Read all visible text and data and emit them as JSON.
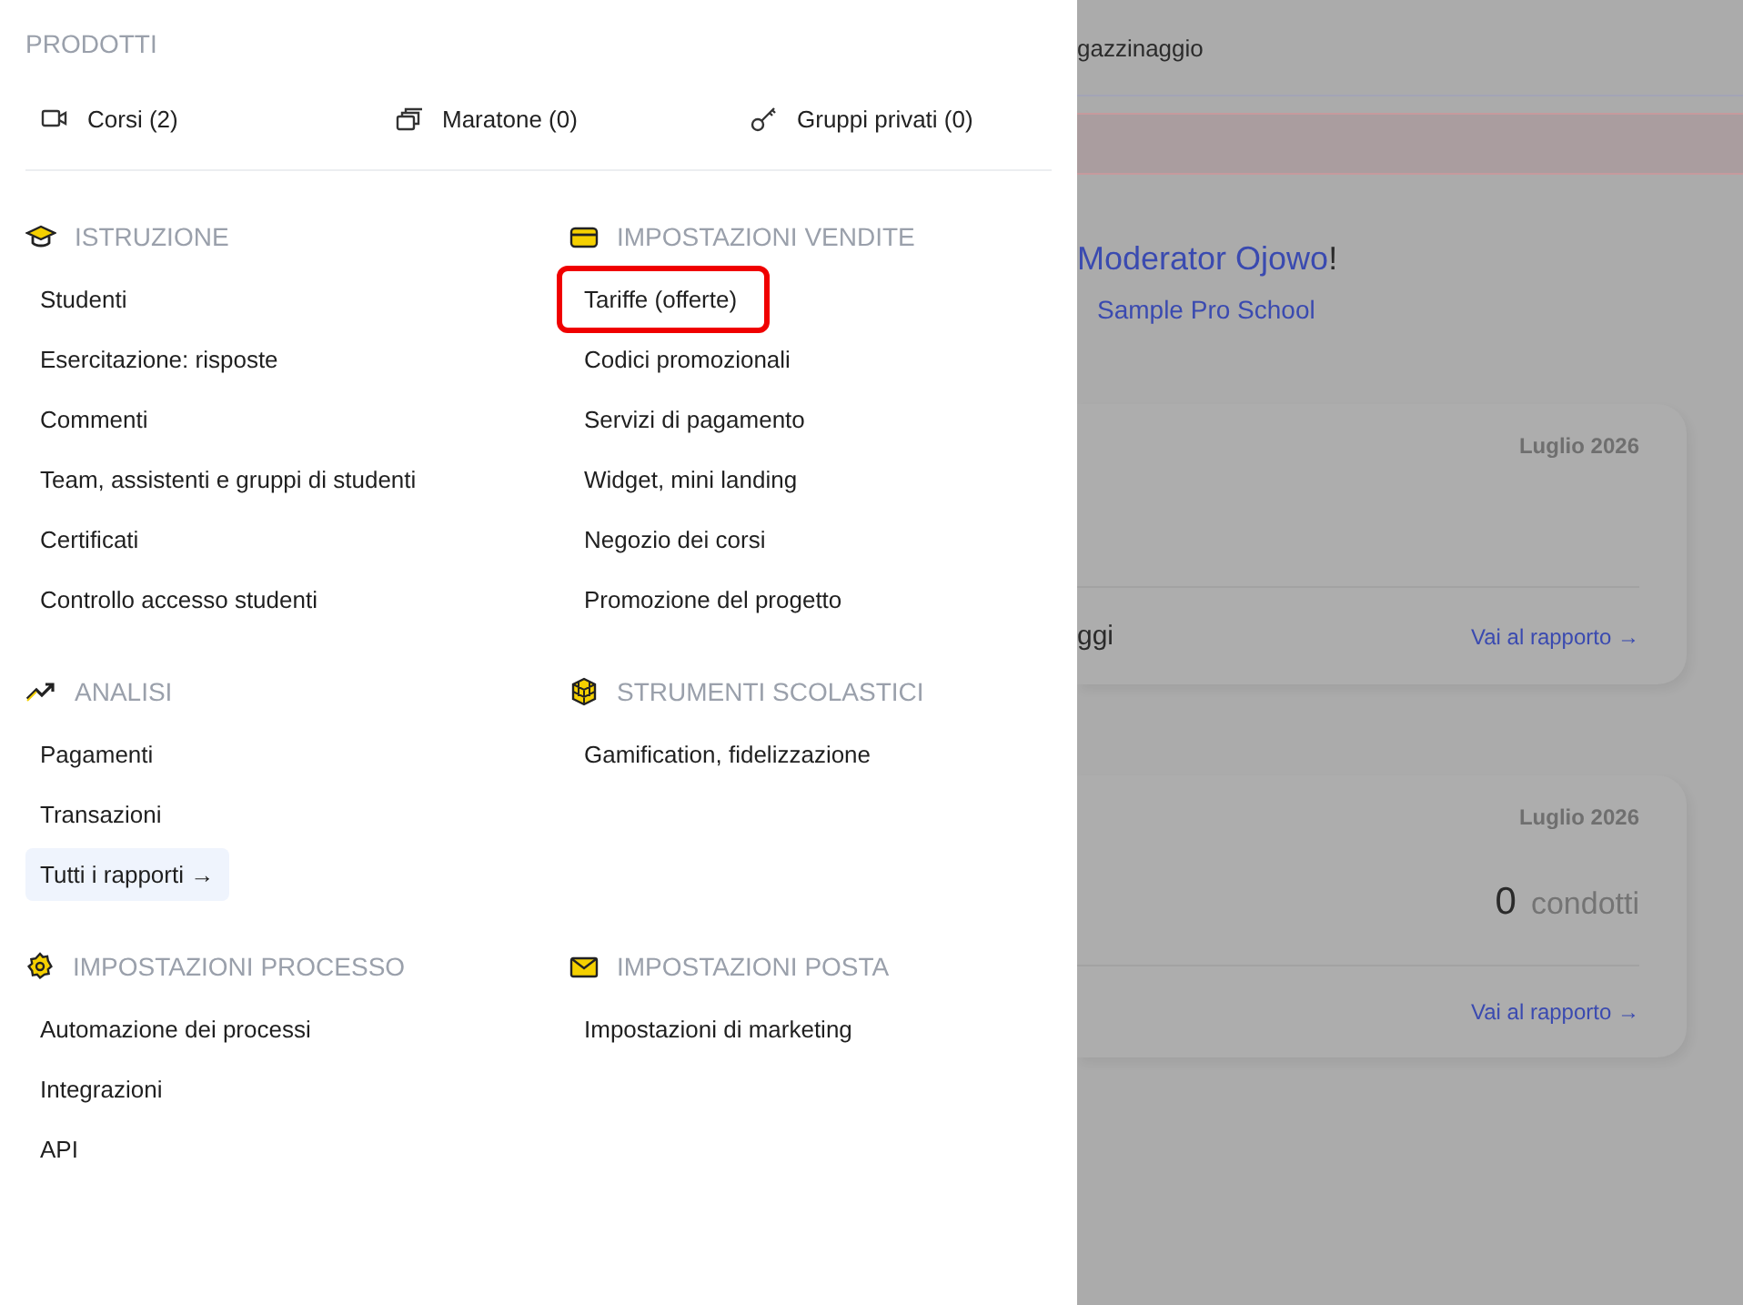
{
  "menu": {
    "products_title": "PRODOTTI",
    "products": [
      {
        "label": "Corsi (2)"
      },
      {
        "label": "Maratone (0)"
      },
      {
        "label": "Gruppi privati (0)"
      }
    ],
    "sections": [
      {
        "title": "ISTRUZIONE",
        "items": [
          {
            "label": "Studenti",
            "highlighted": false
          },
          {
            "label": "Esercitazione: risposte",
            "highlighted": false
          },
          {
            "label": "Commenti",
            "highlighted": false
          },
          {
            "label": "Team, assistenti e gruppi di studenti",
            "highlighted": false
          },
          {
            "label": "Certificati",
            "highlighted": false
          },
          {
            "label": "Controllo accesso studenti",
            "highlighted": false
          }
        ]
      },
      {
        "title": "IMPOSTAZIONI VENDITE",
        "items": [
          {
            "label": "Tariffe (offerte)",
            "highlighted": true
          },
          {
            "label": "Codici promozionali",
            "highlighted": false
          },
          {
            "label": "Servizi di pagamento",
            "highlighted": false
          },
          {
            "label": "Widget, mini landing",
            "highlighted": false
          },
          {
            "label": "Negozio dei corsi",
            "highlighted": false
          },
          {
            "label": "Promozione del progetto",
            "highlighted": false
          }
        ]
      },
      {
        "title": "ANALISI",
        "items": [
          {
            "label": "Pagamenti",
            "highlighted": false,
            "kind": "item"
          },
          {
            "label": "Transazioni",
            "highlighted": false,
            "kind": "item"
          },
          {
            "label": "Tutti i rapporti →",
            "highlighted": false,
            "kind": "more"
          }
        ]
      },
      {
        "title": "STRUMENTI SCOLASTICI",
        "items": [
          {
            "label": "Gamification, fidelizzazione",
            "highlighted": false
          }
        ]
      },
      {
        "title": "IMPOSTAZIONI PROCESSO",
        "items": [
          {
            "label": "Automazione dei processi",
            "highlighted": false
          },
          {
            "label": "Integrazioni",
            "highlighted": false
          },
          {
            "label": "API",
            "highlighted": false
          }
        ]
      },
      {
        "title": "IMPOSTAZIONI POSTA",
        "items": [
          {
            "label": "Impostazioni di marketing",
            "highlighted": false
          }
        ]
      }
    ]
  },
  "page": {
    "header_text": "gazzinaggio",
    "greeting": {
      "name": "Moderator Ojowo",
      "suffix": "!"
    },
    "school": "Sample Pro School",
    "cards": [
      {
        "period": "Luglio 2026",
        "footer_label": "ggi",
        "link": "Vai al rapporto →"
      },
      {
        "period": "Luglio 2026",
        "value": "0",
        "unit": "condotti",
        "link": "Vai al rapporto →"
      }
    ]
  }
}
